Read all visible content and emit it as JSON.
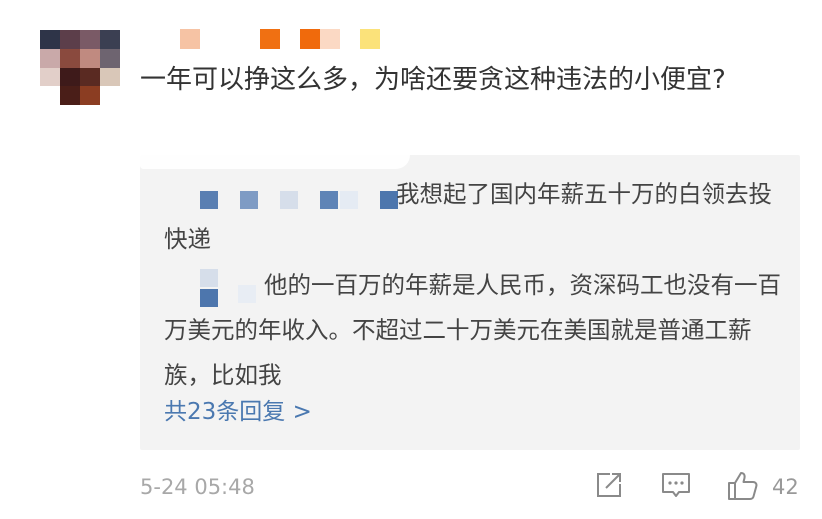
{
  "comment": {
    "text": "一年可以挣这么多，为啥还要贪这种违法的小便宜?"
  },
  "replies": [
    {
      "text": "我想起了国内年薪五十万的白领去投快递"
    },
    {
      "text": "他的一百万的年薪是人民币，资深码工也没有一百万美元的年收入。不超过二十万美元在美国就是普通工薪族，比如我"
    }
  ],
  "more_replies_label": "共23条回复 >",
  "footer": {
    "timestamp": "5-24 05:48",
    "like_count": "42"
  },
  "icons": {
    "share": "share-icon",
    "comment": "comment-icon",
    "like": "thumbs-up-icon"
  },
  "colors": {
    "link": "#4a78b0",
    "reply_bg": "#f3f3f3",
    "meta_text": "#a8a8a8"
  }
}
